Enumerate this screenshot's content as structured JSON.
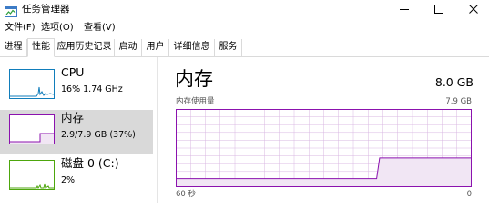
{
  "window": {
    "title": "任务管理器",
    "accent_color": "#9528b4"
  },
  "menu": {
    "items": [
      {
        "label": "文件(F)"
      },
      {
        "label": "选项(O)"
      },
      {
        "label": "查看(V)"
      }
    ]
  },
  "tabs": [
    {
      "label": "进程",
      "active": false
    },
    {
      "label": "性能",
      "active": true
    },
    {
      "label": "应用历史记录",
      "active": false
    },
    {
      "label": "启动",
      "active": false
    },
    {
      "label": "用户",
      "active": false
    },
    {
      "label": "详细信息",
      "active": false
    },
    {
      "label": "服务",
      "active": false
    }
  ],
  "resources": [
    {
      "name": "CPU",
      "detail": "16%  1.74 GHz",
      "selected": false,
      "color": "#117dbb",
      "icon": "cpu-thumbnail-graph"
    },
    {
      "name": "内存",
      "detail": "2.9/7.9 GB (37%)",
      "selected": true,
      "color": "#8b12ae",
      "icon": "memory-thumbnail-graph"
    },
    {
      "name": "磁盘 0 (C:)",
      "detail": "2%",
      "selected": false,
      "color": "#4da60c",
      "icon": "disk-thumbnail-graph"
    }
  ],
  "detail": {
    "title": "内存",
    "total": "8.0 GB",
    "graph_label": "内存使用量",
    "graph_max": "7.9 GB",
    "axis_left": "60 秒",
    "axis_right": "0",
    "line_color": "#8b12ae",
    "fill_color": "#f1e6f4",
    "grid_color": "#d8b7e2",
    "usage_series": [
      {
        "t": 0,
        "pct": 10
      },
      {
        "t": 0.68,
        "pct": 10
      },
      {
        "t": 0.69,
        "pct": 37
      },
      {
        "t": 1,
        "pct": 37
      }
    ]
  }
}
